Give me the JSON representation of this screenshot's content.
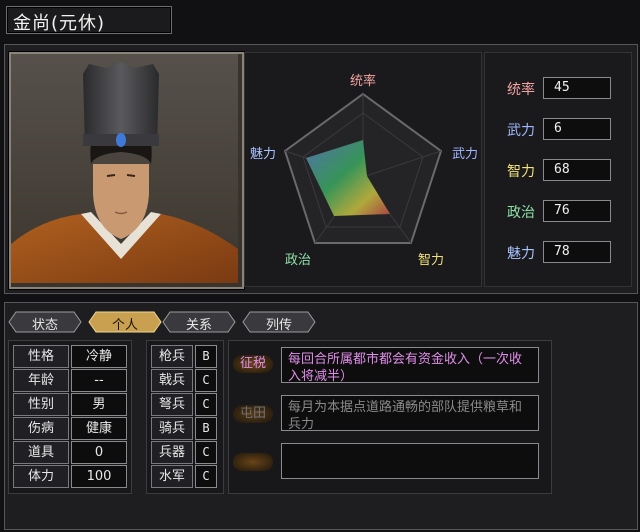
{
  "officer": {
    "name": "金尚",
    "style_name": "(元休)"
  },
  "radar": {
    "labels": [
      "统率",
      "武力",
      "智力",
      "政治",
      "魅力"
    ],
    "label_colors": [
      "#f2a3a3",
      "#9fb8ff",
      "#f2e27a",
      "#8fe0a8",
      "#a9c4ff"
    ]
  },
  "stats": [
    {
      "label": "统率",
      "value": "45",
      "color": "#f2a3a3"
    },
    {
      "label": "武力",
      "value": "6",
      "color": "#9fb8ff"
    },
    {
      "label": "智力",
      "value": "68",
      "color": "#f2e27a"
    },
    {
      "label": "政治",
      "value": "76",
      "color": "#8fe0a8"
    },
    {
      "label": "魅力",
      "value": "78",
      "color": "#a9c4ff"
    }
  ],
  "tabs": [
    {
      "label": "状态",
      "active": false
    },
    {
      "label": "个人",
      "active": true
    },
    {
      "label": "关系",
      "active": false
    },
    {
      "label": "列传",
      "active": false
    }
  ],
  "personal": [
    {
      "label": "性格",
      "value": "冷静"
    },
    {
      "label": "年龄",
      "value": "--"
    },
    {
      "label": "性别",
      "value": "男"
    },
    {
      "label": "伤病",
      "value": "健康"
    },
    {
      "label": "道具",
      "value": "0"
    },
    {
      "label": "体力",
      "value": "100"
    }
  ],
  "troops": [
    {
      "label": "枪兵",
      "value": "B"
    },
    {
      "label": "戟兵",
      "value": "C"
    },
    {
      "label": "弩兵",
      "value": "C"
    },
    {
      "label": "骑兵",
      "value": "B"
    },
    {
      "label": "兵器",
      "value": "C"
    },
    {
      "label": "水军",
      "value": "C"
    }
  ],
  "skills": [
    {
      "name": "征税",
      "desc": "每回合所属都市都会有资金收入（一次收入将减半）",
      "active": true
    },
    {
      "name": "屯田",
      "desc": "每月为本据点道路通畅的部队提供粮草和兵力",
      "active": false
    },
    {
      "name": "",
      "desc": "",
      "active": false
    }
  ],
  "colors": {
    "accent_gold": "#c8a050",
    "skill_active": "#e08ee8",
    "skill_inactive": "#8a8a8a"
  }
}
